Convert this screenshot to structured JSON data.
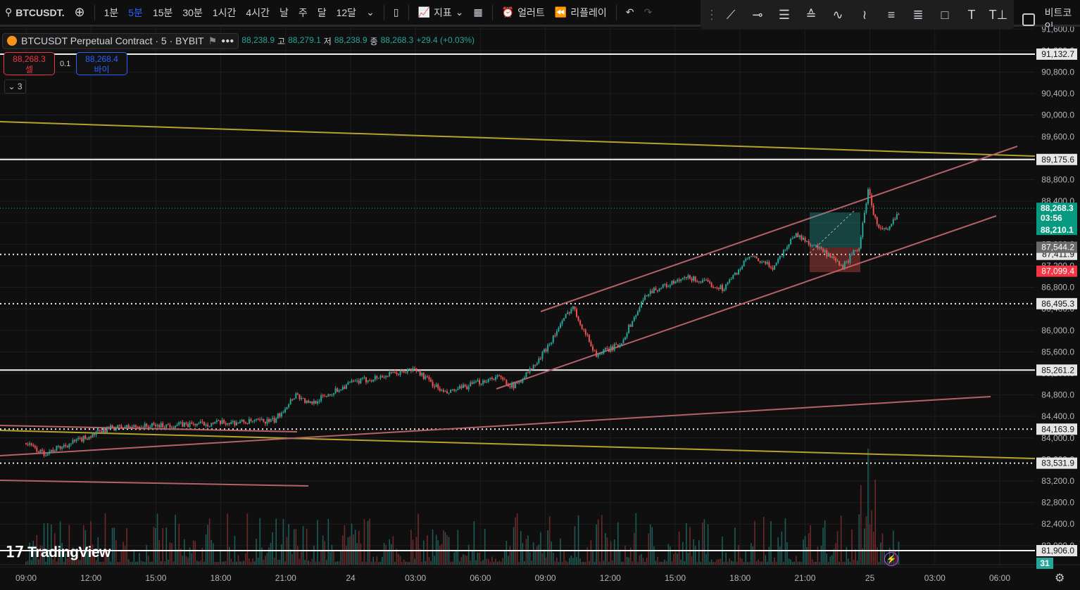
{
  "topbar": {
    "symbol": "BTCUSDT.",
    "intervals": [
      "1분",
      "5분",
      "15분",
      "30분",
      "1시간",
      "4시간",
      "날",
      "주",
      "달",
      "12달"
    ],
    "active_interval": "5분",
    "indicators": "지표",
    "alert": "얼러트",
    "replay": "리플레이"
  },
  "watchlist": {
    "label": "비트코인"
  },
  "legend": {
    "title": "BTCUSDT Perpetual Contract · 5 · BYBIT",
    "open": "88,238.9",
    "high_label": "고",
    "high": "88,279.1",
    "low_label": "저",
    "low": "88,238.9",
    "close_label": "종",
    "close": "88,268.3",
    "change": "+29.4 (+0.03%)"
  },
  "trade": {
    "sell_price": "88,268.3",
    "sell_label": "셀",
    "qty": "0.1",
    "buy_price": "88,268.4",
    "buy_label": "바이"
  },
  "collapse_label": "3",
  "brand": "TradingView",
  "colors": {
    "up": "#26a69a",
    "down": "#ef5350",
    "channel": "#b5616a",
    "trend": "#b5a42c",
    "accent": "#2962ff"
  },
  "chart_data": {
    "type": "candlestick",
    "price_range": [
      81600,
      91600
    ],
    "price_ticks": [
      "91,600.0",
      "91,200.0",
      "90,800.0",
      "90,400.0",
      "90,000.0",
      "89,600.0",
      "89,200.0",
      "88,800.0",
      "88,400.0",
      "88,000.0",
      "87,600.0",
      "87,200.0",
      "86,800.0",
      "86,400.0",
      "86,000.0",
      "85,600.0",
      "85,200.0",
      "84,800.0",
      "84,400.0",
      "84,000.0",
      "83,600.0",
      "83,200.0",
      "82,800.0",
      "82,400.0",
      "82,000.0",
      "81,600.0"
    ],
    "time_ticks": [
      "09:00",
      "12:00",
      "15:00",
      "18:00",
      "21:00",
      "24",
      "03:00",
      "06:00",
      "09:00",
      "12:00",
      "15:00",
      "18:00",
      "21:00",
      "25",
      "03:00",
      "06:00"
    ],
    "close_path_hours": [
      [
        0,
        83905
      ],
      [
        0.8,
        83710
      ],
      [
        4,
        84193
      ],
      [
        11.5,
        84320
      ],
      [
        12.5,
        84820
      ],
      [
        13.1,
        84625
      ],
      [
        15,
        85015
      ],
      [
        17.3,
        85213
      ],
      [
        18,
        85280
      ],
      [
        19.4,
        84820
      ],
      [
        21.8,
        85145
      ],
      [
        22.6,
        84950
      ],
      [
        23.7,
        85410
      ],
      [
        25.3,
        86455
      ],
      [
        26.4,
        85540
      ],
      [
        27.5,
        85735
      ],
      [
        28.8,
        86715
      ],
      [
        30.7,
        86980
      ],
      [
        32.3,
        86780
      ],
      [
        33.5,
        87370
      ],
      [
        34.6,
        87170
      ],
      [
        35.6,
        87790
      ],
      [
        36.8,
        87500
      ],
      [
        37.8,
        87170
      ],
      [
        38.6,
        87565
      ],
      [
        39,
        88610
      ],
      [
        39.4,
        87955
      ],
      [
        39.9,
        87825
      ],
      [
        40.5,
        88268
      ]
    ],
    "horizontal_levels": [
      {
        "price": "91,132.7",
        "style": "solid"
      },
      {
        "price": "89,175.6",
        "style": "solid"
      },
      {
        "price": "86,495.3",
        "style": "dotted"
      },
      {
        "price": "87,411.9",
        "style": "dotted"
      },
      {
        "price": "85,261.2",
        "style": "solid"
      },
      {
        "price": "84,163.9",
        "style": "dotted"
      },
      {
        "price": "83,531.9",
        "style": "dotted"
      },
      {
        "price": "81,906.0",
        "style": "solid"
      }
    ],
    "last_price": {
      "price": "88,268.3",
      "countdown": "03:56",
      "extra": "88,210.1"
    },
    "position_labels": {
      "entry": "87,544.2",
      "stop": "87,099.4"
    },
    "volume_badge": "31"
  }
}
